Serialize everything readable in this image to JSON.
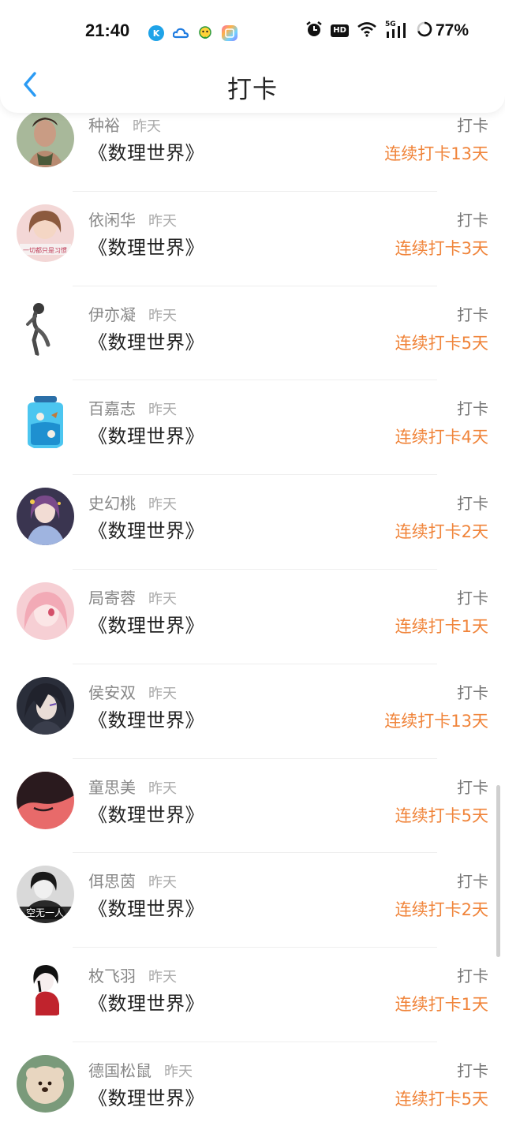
{
  "status_bar": {
    "time": "21:40",
    "app_icons": [
      "k-app-icon",
      "cloud-app-icon",
      "chat-app-icon",
      "gallery-app-icon"
    ],
    "hd_label": "HD",
    "network_label": "5G",
    "battery": "77%"
  },
  "nav": {
    "title": "打卡",
    "back_icon": "chevron-left-icon",
    "accent": "#2b9bf4"
  },
  "colors": {
    "streak": "#f0843a",
    "name": "#888888",
    "divider": "#eeeeee"
  },
  "rows": [
    {
      "name": "种裕",
      "when": "昨天",
      "book": "《数理世界》",
      "action": "打卡",
      "streak": "连续打卡13天"
    },
    {
      "name": "依闲华",
      "when": "昨天",
      "book": "《数理世界》",
      "action": "打卡",
      "streak": "连续打卡3天"
    },
    {
      "name": "伊亦凝",
      "when": "昨天",
      "book": "《数理世界》",
      "action": "打卡",
      "streak": "连续打卡5天"
    },
    {
      "name": "百嘉志",
      "when": "昨天",
      "book": "《数理世界》",
      "action": "打卡",
      "streak": "连续打卡4天"
    },
    {
      "name": "史幻桃",
      "when": "昨天",
      "book": "《数理世界》",
      "action": "打卡",
      "streak": "连续打卡2天"
    },
    {
      "name": "局寄蓉",
      "when": "昨天",
      "book": "《数理世界》",
      "action": "打卡",
      "streak": "连续打卡1天"
    },
    {
      "name": "侯安双",
      "when": "昨天",
      "book": "《数理世界》",
      "action": "打卡",
      "streak": "连续打卡13天"
    },
    {
      "name": "童思美",
      "when": "昨天",
      "book": "《数理世界》",
      "action": "打卡",
      "streak": "连续打卡5天"
    },
    {
      "name": "佴思茵",
      "when": "昨天",
      "book": "《数理世界》",
      "action": "打卡",
      "streak": "连续打卡2天"
    },
    {
      "name": "枚飞羽",
      "when": "昨天",
      "book": "《数理世界》",
      "action": "打卡",
      "streak": "连续打卡1天"
    },
    {
      "name": "德国松鼠",
      "when": "昨天",
      "book": "《数理世界》",
      "action": "打卡",
      "streak": "连续打卡5天"
    }
  ],
  "avatar_text": {
    "avatar_2": "一切都只是习惯",
    "avatar_9": "空无一人"
  }
}
